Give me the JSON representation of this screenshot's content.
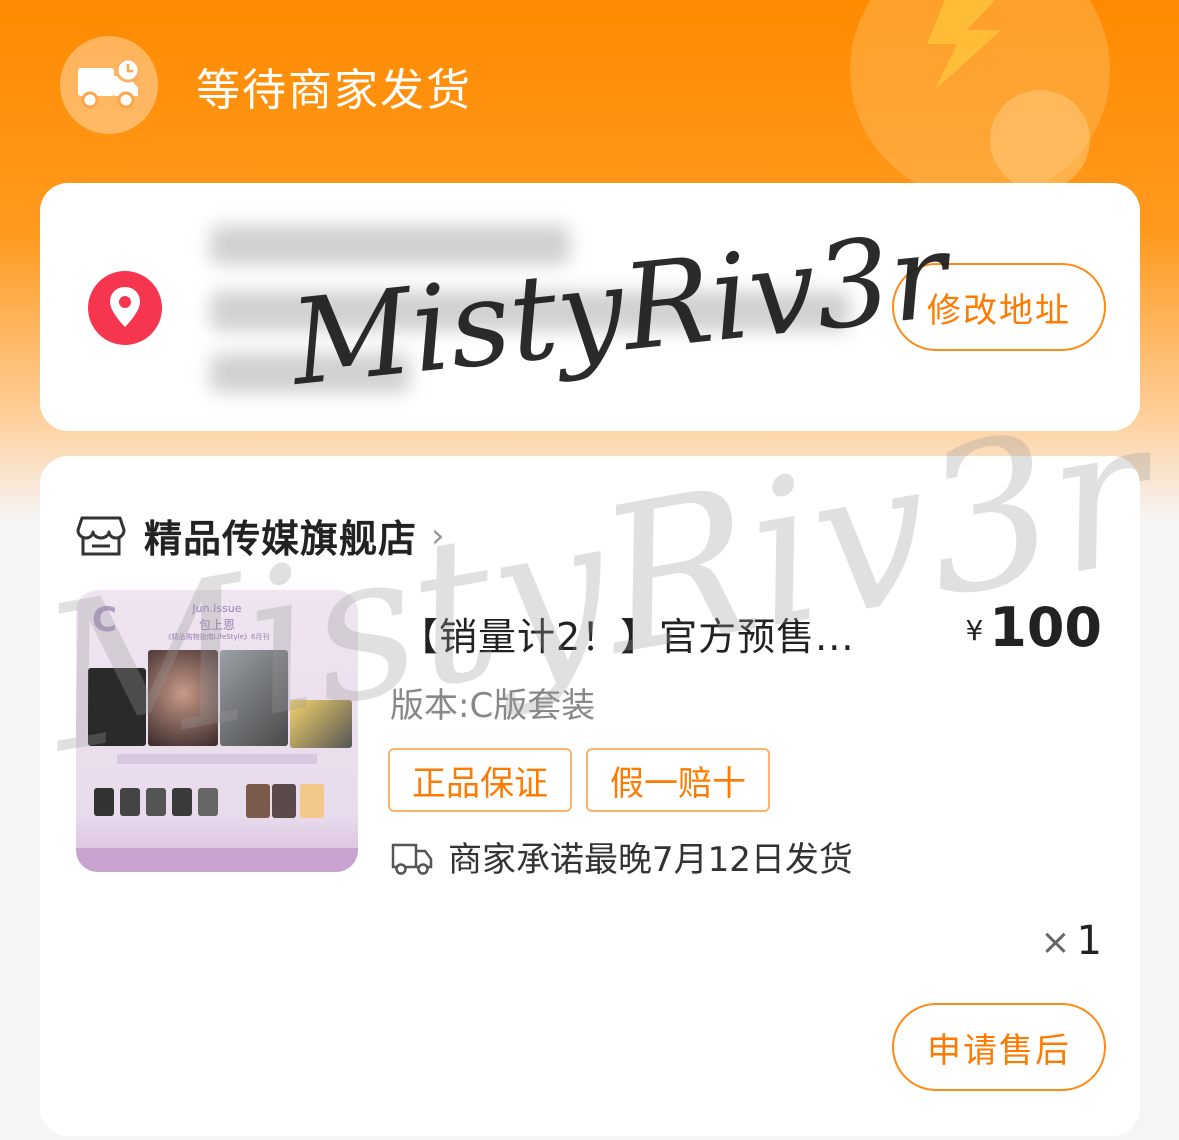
{
  "status": {
    "text": "等待商家发货",
    "icon": "truck-clock-icon"
  },
  "address": {
    "edit_label": "修改地址",
    "icon": "location-pin-icon"
  },
  "store": {
    "name": "精品传媒旗舰店",
    "icon": "store-icon",
    "chevron": "›"
  },
  "product": {
    "title": "【销量计2！】官方预售...",
    "currency": "¥",
    "price": "100",
    "variant": "版本:C版套装",
    "tags": [
      "正品保证",
      "假一赔十"
    ],
    "shipping_note": "商家承诺最晚7月12日发货",
    "qty_symbol": "×",
    "qty": "1",
    "thumbnail": {
      "letter": "C",
      "issue": "Jun.Issue",
      "subtitle": "包上恩",
      "note": "《精品购物指南LifeStyle》6月刊"
    }
  },
  "actions": {
    "after_sale_label": "申请售后"
  },
  "watermark": "MistyRiv3r",
  "colors": {
    "accent": "#ff7a00",
    "header": "#ff8a00",
    "pin": "#f5364e"
  }
}
